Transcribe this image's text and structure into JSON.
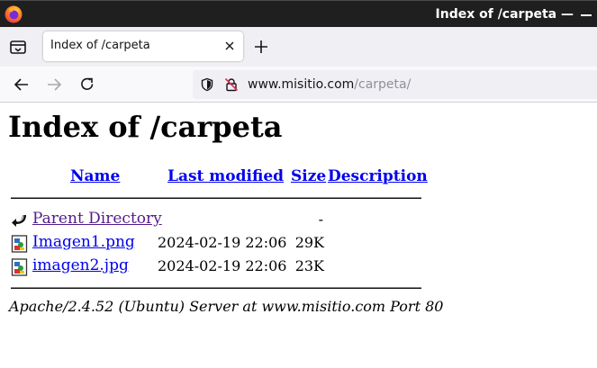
{
  "window": {
    "title": "Index of /carpeta —",
    "browser_icon": "firefox-logo-icon"
  },
  "tabs": [
    {
      "label": "Index of /carpeta",
      "active": true
    }
  ],
  "toolbar": {
    "url_host": "www.misitio.com",
    "url_path": "/carpeta/"
  },
  "page": {
    "heading": "Index of /carpeta",
    "columns": {
      "name": "Name",
      "last_modified": "Last modified",
      "size": "Size",
      "description": "Description"
    },
    "entries": [
      {
        "name": "Parent Directory",
        "modified": "",
        "size": "-",
        "icon": "back-arrow-icon"
      },
      {
        "name": "Imagen1.png",
        "modified": "2024-02-19 22:06",
        "size": "29K",
        "icon": "image-file-icon"
      },
      {
        "name": "imagen2.jpg",
        "modified": "2024-02-19 22:06",
        "size": "23K",
        "icon": "image-file-icon"
      }
    ],
    "footer": "Apache/2.4.52 (Ubuntu) Server at www.misitio.com Port 80"
  },
  "colors": {
    "titlebar": "#1f1f1f",
    "link": "#0000ee",
    "visited_link": "#551a8b"
  }
}
